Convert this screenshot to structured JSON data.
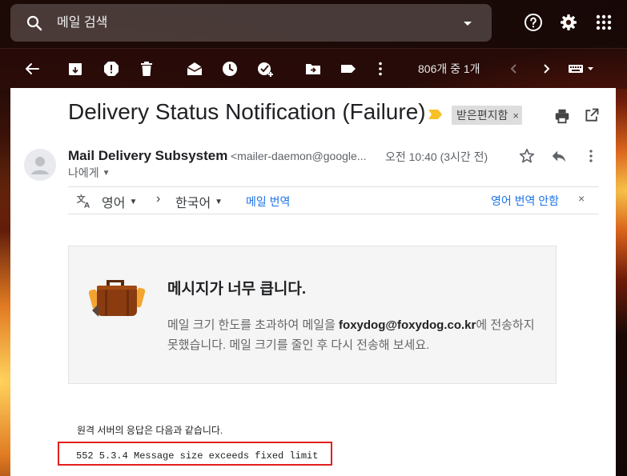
{
  "search": {
    "placeholder": "메일 검색"
  },
  "toolbar": {
    "pager": "806개 중 1개"
  },
  "email": {
    "subject": "Delivery Status Notification (Failure)",
    "label": "받은편지함",
    "sender_name": "Mail Delivery Subsystem",
    "sender_email": "<mailer-daemon@google...",
    "time": "오전 10:40 (3시간 전)",
    "to": "나에게"
  },
  "translate": {
    "from_lang": "영어",
    "arrow": "›",
    "to_lang": "한국어",
    "translate_label": "메일 번역",
    "never_label": "영어 번역 안함",
    "close": "×"
  },
  "bounce": {
    "title": "메시지가 너무 큽니다.",
    "msg_before": "메일 크기 한도를 초과하여 메일을 ",
    "recipient": "foxydog@foxydog.co.kr",
    "msg_after": "에 전송하지 못했습니다. 메일 크기를 줄인 후 다시 전송해 보세요."
  },
  "server": {
    "label": "원격 서버의 응답은 다음과 같습니다.",
    "code": "552 5.3.4 Message size exceeds fixed limit"
  },
  "colors": {
    "link": "#1a73e8",
    "error_border": "#e02020",
    "importance": "#f6c026"
  }
}
